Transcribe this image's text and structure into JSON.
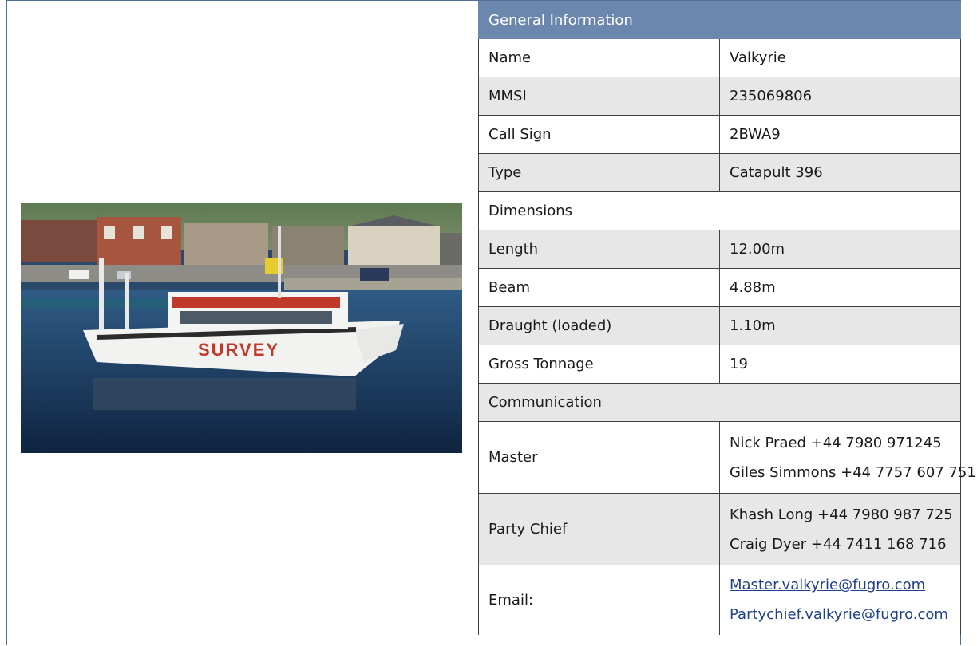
{
  "header": "General Information",
  "rows": {
    "name": {
      "label": "Name",
      "value": "Valkyrie"
    },
    "mmsi": {
      "label": "MMSI",
      "value": "235069806"
    },
    "call_sign": {
      "label": "Call Sign",
      "value": "2BWA9"
    },
    "type": {
      "label": "Type",
      "value": "Catapult 396"
    }
  },
  "dimensions": {
    "section": "Dimensions",
    "length": {
      "label": "Length",
      "value": "12.00m"
    },
    "beam": {
      "label": "Beam",
      "value": "4.88m"
    },
    "draught": {
      "label": "Draught (loaded)",
      "value": "1.10m"
    },
    "tonnage": {
      "label": "Gross Tonnage",
      "value": "19"
    }
  },
  "communication": {
    "section": "Communication",
    "master": {
      "label": "Master",
      "lines": [
        "Nick Praed +44 7980 971245",
        "Giles Simmons +44 7757 607 751"
      ]
    },
    "party_chief": {
      "label": "Party Chief",
      "lines": [
        "Khash Long +44 7980 987 725",
        "Craig Dyer +44 7411 168 716"
      ]
    },
    "email": {
      "label": "Email:",
      "lines": [
        "Master.valkyrie@fugro.com",
        "Partychief.valkyrie@fugro.com"
      ]
    }
  },
  "photo": {
    "hull_text": "SURVEY",
    "colors": {
      "sky": "#6f8ea8",
      "water": "#1d3a5c",
      "hull": "#f2f2f0",
      "stripe": "#c0392b"
    }
  }
}
